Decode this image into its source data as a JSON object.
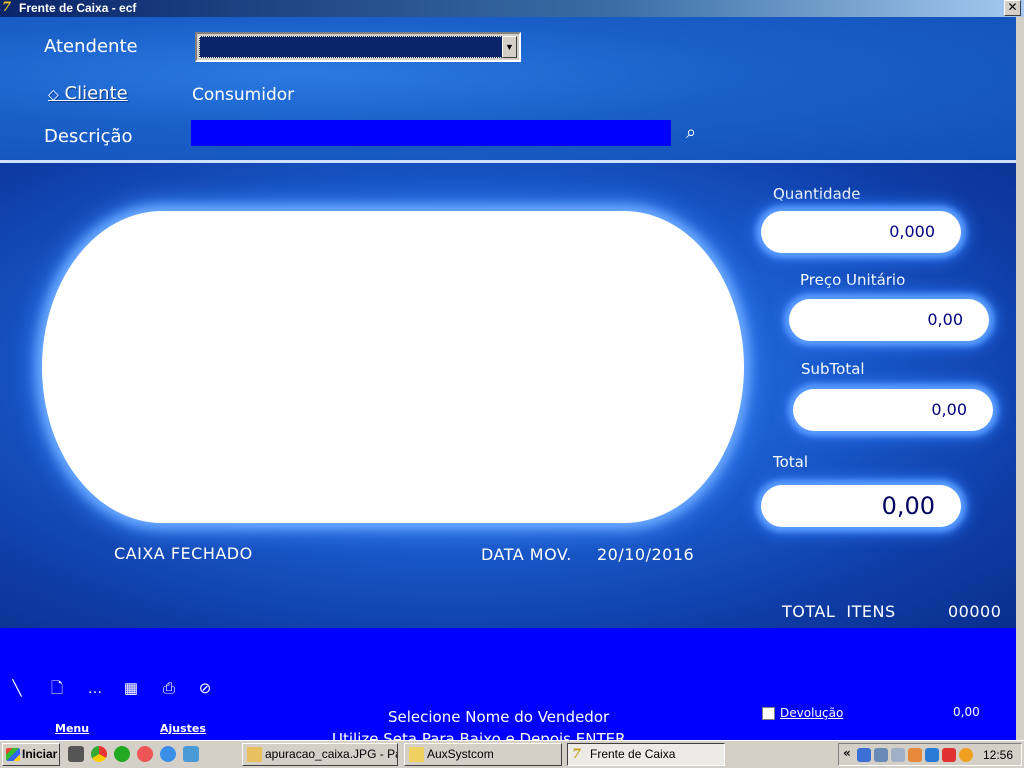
{
  "window": {
    "title": "Frente de Caixa - ecf",
    "close_label": "✕"
  },
  "header": {
    "atendente_label": "Atendente",
    "atendente_value": "",
    "cliente_label": "Cliente",
    "cliente_value": "Consumidor",
    "descricao_label": "Descrição",
    "descricao_value": ""
  },
  "fields": {
    "quantidade": {
      "label": "Quantidade",
      "value": "0,000"
    },
    "preco_unitario": {
      "label": "Preço Unitário",
      "value": "0,00"
    },
    "subtotal": {
      "label": "SubTotal",
      "value": "0,00"
    },
    "total": {
      "label": "Total",
      "value": "0,00"
    }
  },
  "status": {
    "caixa": "CAIXA FECHADO",
    "data_mov_label": "DATA MOV.",
    "data_mov_value": "20/10/2016",
    "total_itens_label": "TOTAL  ITENS",
    "total_itens_value": "00000"
  },
  "bottom": {
    "menu_label": "Menu",
    "ajustes_label": "Ajustes",
    "message": "Selecione Nome do Vendedor",
    "message2": "Utilize Seta Para Baixo e Depois ENTER",
    "devolucao_label": "Devolução",
    "devolucao_value": "0,00"
  },
  "taskbar": {
    "start_label": "Iniciar",
    "tasks": [
      "apuracao_caixa.JPG - Paint",
      "AuxSystcom",
      "Frente de Caixa"
    ],
    "clock": "12:56",
    "tray_chevron": "«"
  },
  "icons": {
    "app": "7",
    "search": "⌕",
    "select_arrow": "▼",
    "cliente_prefix": "◇"
  },
  "colors": {
    "window_blue": "#0000ff",
    "field_text": "#000080",
    "select_bg": "#0a246a"
  }
}
